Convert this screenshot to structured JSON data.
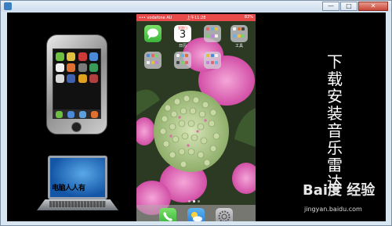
{
  "window": {
    "minimize_label": "—",
    "maximize_label": "□",
    "close_label": "✕"
  },
  "laptop": {
    "screen_text": "电脑人人有"
  },
  "phone": {
    "status": {
      "carrier": "••• vodafone AU",
      "time": "上午11:28",
      "battery": "83%"
    },
    "calendar": {
      "weekday": "星期日",
      "date": "3",
      "label": "日历"
    },
    "folder_label": "工具"
  },
  "caption": "下载安装音乐雷达",
  "watermark": {
    "logo": "Bai度 经验",
    "url": "jingyan.baidu.com"
  },
  "colors": {
    "status_bar": "#e94a4a",
    "background": "#000000"
  }
}
